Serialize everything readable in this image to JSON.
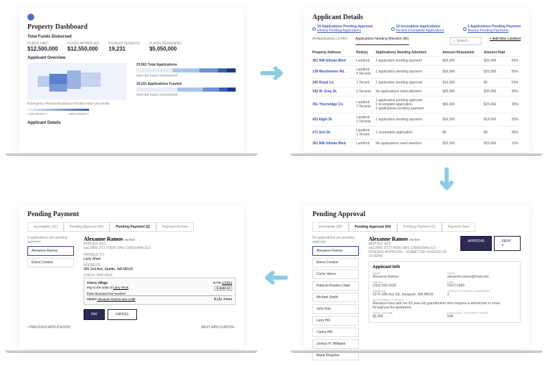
{
  "dashboard": {
    "title": "Property Dashboard",
    "funds_heading": "Total Funds Disbursed",
    "metrics": [
      {
        "label": "FUNDS PAID",
        "value": "$12,500,000"
      },
      {
        "label": "FUNDS APPROVED",
        "value": "$12,550,000"
      },
      {
        "label": "FUNDED TENANTS",
        "value": "19,231"
      },
      {
        "label": "FUNDS REMAINING",
        "value": "$5,050,000"
      }
    ],
    "overview_heading": "Applicant Overview",
    "total_apps": "23,562 Total Applications",
    "funded_apps": "19,231 Applications Funded",
    "legend_note": "view top tracts represented",
    "priority_caption": "Emergency Rental Assistance Priority Index percentile",
    "priority_low": "LOW PRIORITY",
    "priority_high": "HIGH PRIORITY",
    "details_heading": "Applicant Details"
  },
  "details": {
    "title": "Applicant Details",
    "pills": [
      {
        "label": "19 Applications Pending Approval",
        "link": "Review Pending Applications"
      },
      {
        "label": "10 Incomplete Applications",
        "link": "Review Incomplete Applications"
      },
      {
        "label": "2 Applications Pending Payment",
        "link": "Review Pending Payments"
      }
    ],
    "tab_all": "All Applications",
    "tab_all_count": "(3,640)",
    "tab_attn": "Applications Needing Attention",
    "tab_attn_count": "(80)",
    "search_placeholder": "Search…",
    "add_landlord": "+ Add New Landlord",
    "columns": [
      "Property Address",
      "Role(s)",
      "Applications Needing Attention",
      "Amount Requested",
      "Amount Paid",
      ""
    ],
    "rows": [
      {
        "addr": "351 NW Gilman Blvd",
        "role": "Landlord",
        "attn": "1 application pending payment",
        "req": "$20,000",
        "paid": "$25,000",
        "pct": "56%"
      },
      {
        "addr": "139 Westheimer Rd.",
        "role": "Landlord\n4 Tenants",
        "attn": "1 application pending payment",
        "req": "$20,000",
        "paid": "$25,000",
        "pct": "55%"
      },
      {
        "addr": "245 Royal Ln.",
        "role": "1 Tenant",
        "attn": "1 application pending approval",
        "req": "$15,000",
        "paid": "$0",
        "pct": "53%"
      },
      {
        "addr": "342 W. Gray St.",
        "role": "2 Tenants",
        "attn": "No applications need attention",
        "req": "$25,000",
        "paid": "$30,000",
        "pct": "35%"
      },
      {
        "addr": "351 Thornridge Cir.",
        "role": "Landlord\n7 Tenants",
        "attn": "1 application pending approval\n1 incomplete application\n2 applications pending payment",
        "req": "$50,000",
        "paid": "$25,000",
        "pct": "35%"
      },
      {
        "addr": "433 Elgin St.",
        "role": "Landlord\n2 Tenants",
        "attn": "1 application pending payment",
        "req": "$30,500",
        "paid": "$18,000",
        "pct": "35%"
      },
      {
        "addr": "271 Ash Dr.",
        "role": "Landlord\n1 Tenant",
        "attn": "1 incomplete application",
        "req": "$0",
        "paid": "$0",
        "pct": "35%"
      },
      {
        "addr": "351 NW Gilman Blvd",
        "role": "Landlord",
        "attn": "No applications need attention",
        "req": "$20,000",
        "paid": "$25,000",
        "pct": "15%"
      }
    ]
  },
  "approval": {
    "title": "Pending Approval",
    "crumbs": [
      "Incomplete (30)",
      "Pending Approval (54)",
      "Pending Payment (2)",
      "Payment Sent"
    ],
    "status_line": "54 applications are pending approval",
    "list": [
      "Alexanne Ramos",
      "Elena Condon",
      "Curtis Vance",
      "Patricia Flowers-Clark",
      "Michael Smith",
      "John Kim",
      "Larry Hill",
      "Carlos Hill",
      "Joshus H. Williams",
      "Marie Kingston"
    ],
    "person_name": "Alexanne Ramos",
    "person_suffix": "she/her",
    "applied": "APPLIED 4/13",
    "case_id": "wa12886-1f727-8936-3801-C805036f4c2LD",
    "status": "PENDING APPROVAL · SUBMITTED 4/16/2022 AT 10:30PM",
    "approve": "APPROVE",
    "deny": "DENY",
    "section": "Applicant Info",
    "fields": {
      "name_lbl": "NAME",
      "name": "Alexanne Ramos",
      "email_lbl": "EMAIL",
      "email": "alexanne.ramos@mail.com",
      "phone_lbl": "PHONE",
      "phone": "(253) 555-0108",
      "dob_lbl": "DOB",
      "dob": "03/27/1983",
      "addr_lbl": "ADDRESS",
      "addr": "1576 10th Ave SE, Issaquah, WA 98029",
      "members_lbl": "OTHER HOUSEHOLD MEMBERS",
      "members": "2",
      "notes_lbl": "ACCESSIBILITY NOTES",
      "notes": "Alexanne lives with her 83 year-old grandmother who requires a wheelchair to move throughout the apartment.",
      "income_lbl": "TOTAL INCOME",
      "income": "$2,000",
      "landlord_lbl": "LANDLORD / PROPERTY MGMT",
      "landlord": "N/A"
    }
  },
  "payment": {
    "title": "Pending Payment",
    "crumbs": [
      "Incomplete (30)",
      "Pending Approval (54)",
      "Pending Payment (2)",
      "Payment Archive"
    ],
    "status_line": "2 applications are pending payment",
    "list": [
      "Alexanne Ramos",
      "Elena Condon"
    ],
    "person_name": "Alexanne Ramos",
    "person_suffix": "she/her",
    "applied": "APPLIED 4/13",
    "case_id": "wa12886-1f727-8936-3801-C805036f4c2LD",
    "pay_to_lbl": "PAYABLE TO",
    "pay_to": "Larry Short",
    "addr_lbl": "ADDRESS",
    "addr": "905 2nd Ave, Seattle, WA 98104",
    "preview_lbl": "CHECK PREVIEW",
    "check": {
      "bank": "Cherry Village",
      "date_lbl": "DATE",
      "date": "4/23/22",
      "payto_lbl": "Pay to the order of",
      "payto": "Larry Short",
      "amount": "$ 3500.00",
      "words": "three thousand five hundred",
      "memo_lbl": "MEMO",
      "memo": "Alexanne Ramos rent credit",
      "signature": "Kyle Jones"
    },
    "pay_btn": "PAY",
    "cancel_btn": "CANCEL",
    "prev": "PREVIOUS APPLICATION",
    "next": "NEXT APPLICATION"
  }
}
